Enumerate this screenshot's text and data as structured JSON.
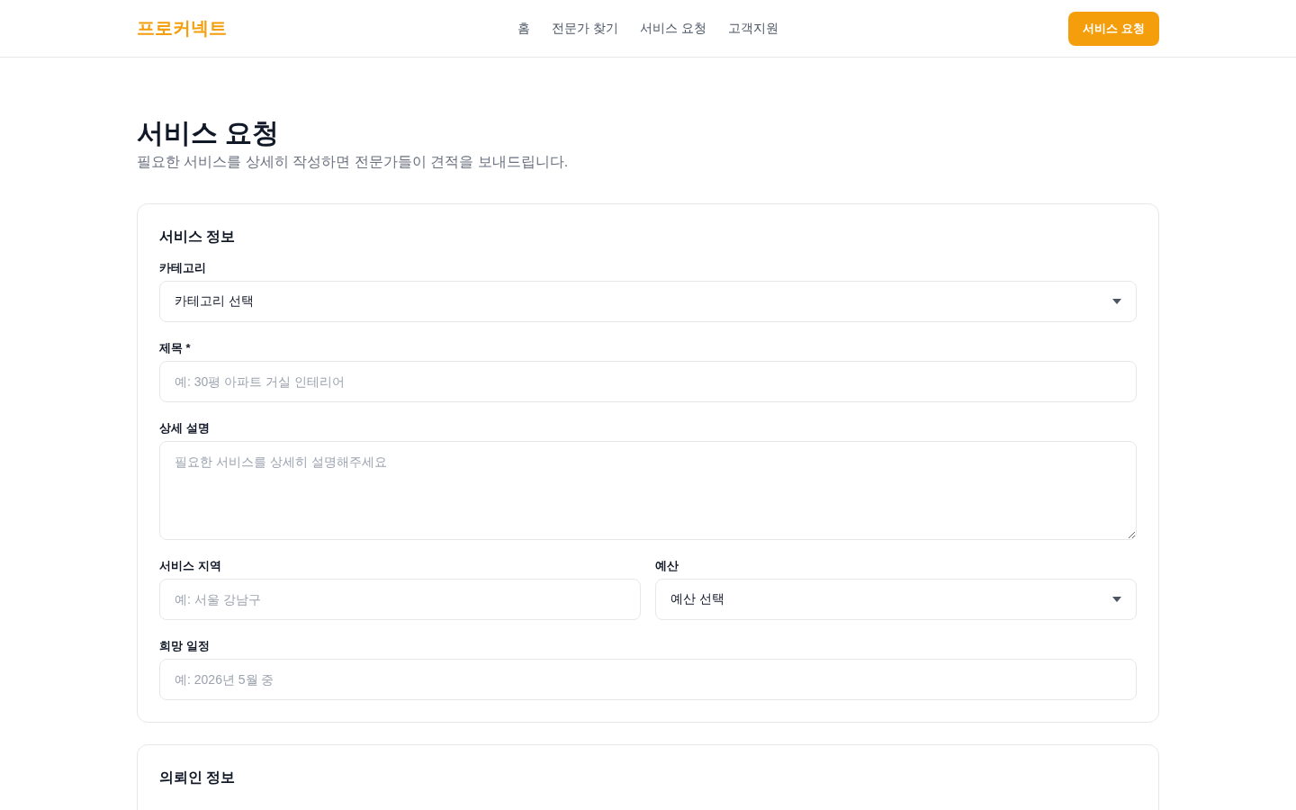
{
  "header": {
    "logo": "프로커넥트",
    "nav": [
      "홈",
      "전문가 찾기",
      "서비스 요청",
      "고객지원"
    ],
    "cta": "서비스 요청"
  },
  "page": {
    "title": "서비스 요청",
    "subtitle": "필요한 서비스를 상세히 작성하면 전문가들이 견적을 보내드립니다."
  },
  "sections": [
    {
      "title": "서비스 정보",
      "rows": [
        [
          {
            "kind": "select",
            "label": "카테고리",
            "value": "카테고리 선택"
          }
        ],
        [
          {
            "kind": "input",
            "label": "제목 *",
            "placeholder": "예: 30평 아파트 거실 인테리어"
          }
        ],
        [
          {
            "kind": "textarea",
            "label": "상세 설명",
            "placeholder": "필요한 서비스를 상세히 설명해주세요"
          }
        ],
        [
          {
            "kind": "input",
            "label": "서비스 지역",
            "placeholder": "예: 서울 강남구"
          },
          {
            "kind": "select",
            "label": "예산",
            "value": "예산 선택"
          }
        ],
        [
          {
            "kind": "input",
            "label": "희망 일정",
            "placeholder": "예: 2026년 5월 중"
          }
        ]
      ]
    },
    {
      "title": "의뢰인 정보"
    }
  ]
}
